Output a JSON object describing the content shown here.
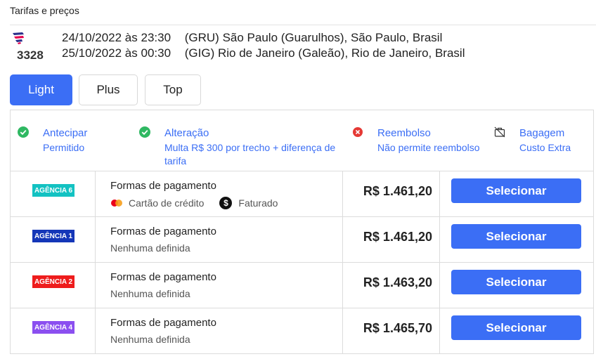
{
  "header": {
    "title": "Tarifas e preços"
  },
  "flight": {
    "number": "3328",
    "logo_icon": "latam-airline-icon",
    "segments": [
      {
        "datetime": "24/10/2022 às 23:30",
        "code": "(GRU)",
        "place": "São Paulo (Guarulhos), São Paulo, Brasil"
      },
      {
        "datetime": "25/10/2022 às 00:30",
        "code": "(GIG)",
        "place": "Rio de Janeiro (Galeão), Rio de Janeiro, Brasil"
      }
    ]
  },
  "tabs": [
    {
      "label": "Light",
      "active": true
    },
    {
      "label": "Plus",
      "active": false
    },
    {
      "label": "Top",
      "active": false
    }
  ],
  "conditions": [
    {
      "title": "Antecipar",
      "desc": "Permitido",
      "icon": "check-circle-icon",
      "color": "#2fb862"
    },
    {
      "title": "Alteração",
      "desc": "Multa R$ 300 por trecho + diferença de tarifa",
      "icon": "check-circle-icon",
      "color": "#2fb862"
    },
    {
      "title": "Reembolso",
      "desc": "Não permite reembolso",
      "icon": "x-circle-icon",
      "color": "#e53935"
    },
    {
      "title": "Bagagem",
      "desc": "Custo Extra",
      "icon": "suitcase-crossed-icon",
      "color": "#333333"
    }
  ],
  "offers": [
    {
      "agency": "AGÊNCIA 6",
      "agency_color": "#13c2c2",
      "pay_title": "Formas de pagamento",
      "pay_card": "Cartão de crédito",
      "pay_invoice": "Faturado",
      "pay_none": "",
      "price": "R$ 1.461,20",
      "button": "Selecionar"
    },
    {
      "agency": "AGÊNCIA 1",
      "agency_color": "#1436b8",
      "pay_title": "Formas de pagamento",
      "pay_card": "",
      "pay_invoice": "",
      "pay_none": "Nenhuma definida",
      "price": "R$ 1.461,20",
      "button": "Selecionar"
    },
    {
      "agency": "AGÊNCIA 2",
      "agency_color": "#ee1c1c",
      "pay_title": "Formas de pagamento",
      "pay_card": "",
      "pay_invoice": "",
      "pay_none": "Nenhuma definida",
      "price": "R$ 1.463,20",
      "button": "Selecionar"
    },
    {
      "agency": "AGÊNCIA 4",
      "agency_color": "#8b4ff0",
      "pay_title": "Formas de pagamento",
      "pay_card": "",
      "pay_invoice": "",
      "pay_none": "Nenhuma definida",
      "price": "R$ 1.465,70",
      "button": "Selecionar"
    }
  ],
  "colors": {
    "accent": "#3b6ef5"
  }
}
